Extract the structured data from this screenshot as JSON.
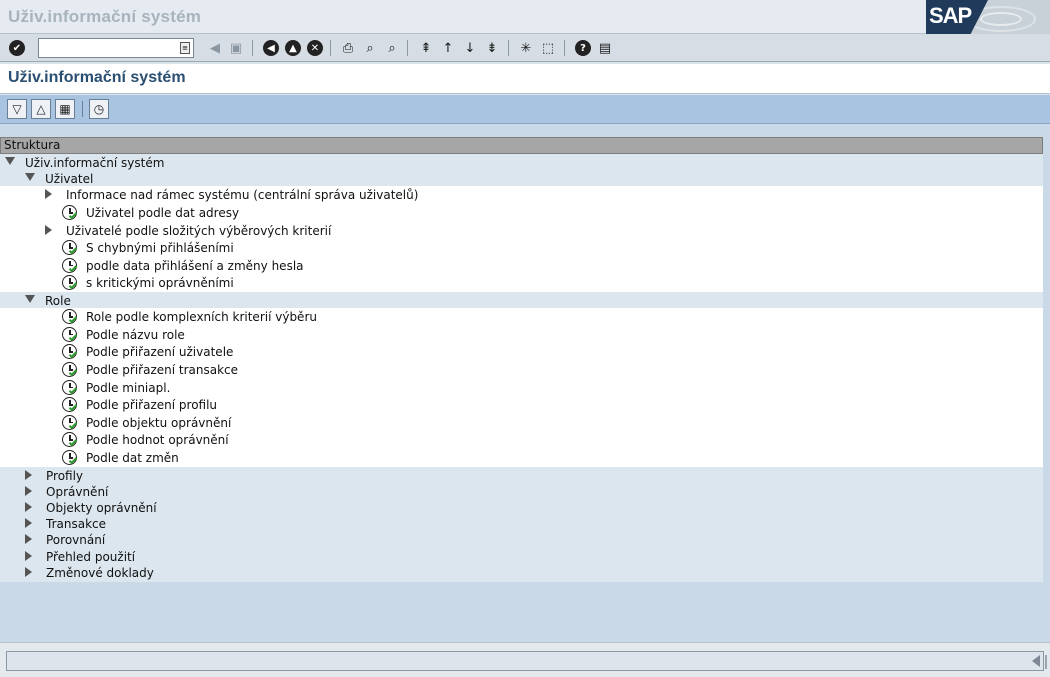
{
  "app_title": "Uživ.informační systém",
  "logo_text": "SAP",
  "screen_title": "Uživ.informační systém",
  "command_field": {
    "value": "",
    "placeholder": ""
  },
  "tree": {
    "header": "Struktura",
    "rows": [
      {
        "label": "Uživ.informační systém",
        "level": 0,
        "kind": "expanded",
        "band": "a"
      },
      {
        "label": "Uživatel",
        "level": 1,
        "kind": "expanded",
        "band": "a"
      },
      {
        "label": "Informace nad rámec systému (centrální správa uživatelů)",
        "level": 2,
        "kind": "collapsed",
        "band": "b"
      },
      {
        "label": "Uživatel podle dat adresy",
        "level": 3,
        "kind": "exec",
        "band": "b"
      },
      {
        "label": "Uživatelé podle složitých výběrových kriterií",
        "level": 2,
        "kind": "collapsed",
        "band": "b"
      },
      {
        "label": "S chybnými přihlášeními",
        "level": 3,
        "kind": "exec",
        "band": "b"
      },
      {
        "label": "podle data přihlášení a změny hesla",
        "level": 3,
        "kind": "exec",
        "band": "b"
      },
      {
        "label": "s kritickými oprávněními",
        "level": 3,
        "kind": "exec",
        "band": "b"
      },
      {
        "label": "Role",
        "level": 1,
        "kind": "expanded",
        "band": "a"
      },
      {
        "label": "Role podle komplexních kriterií výběru",
        "level": 3,
        "kind": "exec",
        "band": "b"
      },
      {
        "label": "Podle názvu role",
        "level": 3,
        "kind": "exec",
        "band": "b"
      },
      {
        "label": "Podle přiřazení uživatele",
        "level": 3,
        "kind": "exec",
        "band": "b"
      },
      {
        "label": "Podle přiřazení transakce",
        "level": 3,
        "kind": "exec",
        "band": "b"
      },
      {
        "label": "Podle miniapl.",
        "level": 3,
        "kind": "exec",
        "band": "b"
      },
      {
        "label": "Podle přiřazení profilu",
        "level": 3,
        "kind": "exec",
        "band": "b"
      },
      {
        "label": "Podle objektu oprávnění",
        "level": 3,
        "kind": "exec",
        "band": "b"
      },
      {
        "label": "Podle hodnot oprávnění",
        "level": 3,
        "kind": "exec",
        "band": "b"
      },
      {
        "label": "Podle dat změn",
        "level": 3,
        "kind": "exec",
        "band": "b"
      },
      {
        "label": "Profily",
        "level": 1,
        "kind": "collapsed",
        "band": "a"
      },
      {
        "label": "Oprávnění",
        "level": 1,
        "kind": "collapsed",
        "band": "a"
      },
      {
        "label": "Objekty oprávnění",
        "level": 1,
        "kind": "collapsed",
        "band": "a"
      },
      {
        "label": "Transakce",
        "level": 1,
        "kind": "collapsed",
        "band": "a"
      },
      {
        "label": "Porovnání",
        "level": 1,
        "kind": "collapsed",
        "band": "a"
      },
      {
        "label": "Přehled použití",
        "level": 1,
        "kind": "collapsed",
        "band": "a"
      },
      {
        "label": "Změnové doklady",
        "level": 1,
        "kind": "collapsed",
        "band": "a"
      }
    ]
  },
  "icons": {
    "std_toolbar": [
      "enter-icon",
      "command-field-dropdown-icon",
      "back-arrow-disabled-icon",
      "save-icon",
      "back-icon",
      "exit-icon",
      "cancel-icon",
      "print-icon",
      "find-icon",
      "find-next-icon",
      "first-page-icon",
      "previous-page-icon",
      "next-page-icon",
      "last-page-icon",
      "create-session-icon",
      "shortcut-icon",
      "help-icon",
      "customize-layout-icon"
    ],
    "app_toolbar": [
      "expand-subtree-icon",
      "collapse-subtree-icon",
      "documentation-icon",
      "execute-icon"
    ]
  }
}
